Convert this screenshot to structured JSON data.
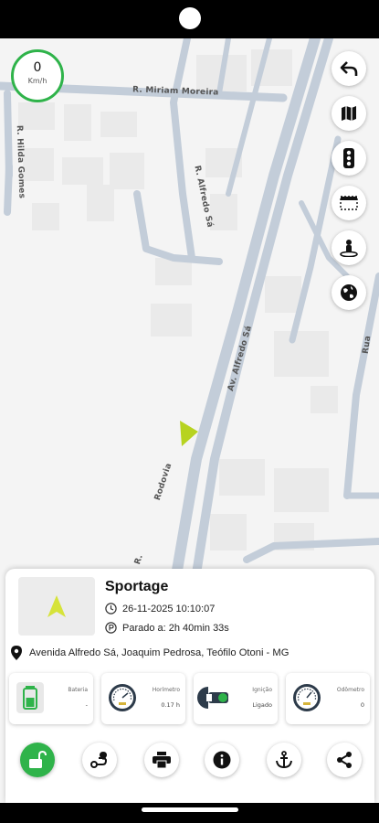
{
  "speed": {
    "value": "0",
    "unit": "Km/h"
  },
  "map": {
    "streets": [
      "R. Miriam Moreira",
      "R. Hilda Gomes",
      "R. Alfredo Sá",
      "Av. Alfredo Sá",
      "Rodovia",
      "Rua",
      "R."
    ]
  },
  "map_controls": [
    "back-arrow-icon",
    "map-icon",
    "traffic-light-icon",
    "layers-icon",
    "street-view-icon",
    "globe-icon"
  ],
  "vehicle": {
    "name": "Sportage",
    "datetime": "26-11-2025 10:10:07",
    "stopped": "Parado a: 2h 40min 33s",
    "address": "Avenida Alfredo Sá, Joaquim Pedrosa, Teófilo Otoni - MG"
  },
  "stats": [
    {
      "label": "Bateria",
      "value": "-",
      "icon": "battery-icon"
    },
    {
      "label": "Horímetro",
      "value": "0.17 h",
      "icon": "gauge-icon"
    },
    {
      "label": "Ignição",
      "value": "Ligado",
      "icon": "ignition-key-icon"
    },
    {
      "label": "Odômetro",
      "value": "0",
      "icon": "odometer-icon"
    }
  ],
  "actions": [
    "unlock-icon",
    "route-icon",
    "print-icon",
    "info-icon",
    "anchor-icon",
    "share-icon"
  ],
  "colors": {
    "accent": "#2fb34a",
    "marker": "#b7d320",
    "road": "#c3cdd9"
  }
}
